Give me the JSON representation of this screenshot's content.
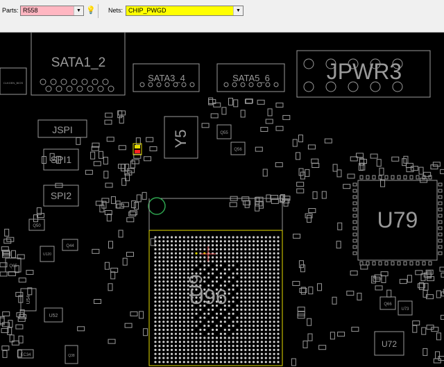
{
  "toolbar": {
    "parts_label": "Parts:",
    "parts_value": "R558",
    "nets_label": "Nets:",
    "nets_value": "CHIP_PWGD",
    "parts_bg": "#ffb6c1",
    "nets_bg": "#ffff00"
  },
  "board": {
    "components": {
      "sata1": "SATA1_2",
      "sata3": "SATA3_4",
      "sata5": "SATA5_6",
      "jpwr3": "JPWR3",
      "jspi": "JSPI",
      "spi1": "SPI1",
      "spi2": "SPI2",
      "y5": "Y5",
      "u79": "U79",
      "u96": "U96",
      "u96b": "U9",
      "q55": "Q55",
      "q56": "Q56",
      "q50": "Q50",
      "q44": "Q44",
      "q65": "Q65",
      "q66": "Q66",
      "u54": "U54",
      "u52": "U52",
      "u72": "U72",
      "u73": "U73",
      "u120": "U120",
      "ec34": "EC34",
      "q38": "Q38",
      "small_left": "CLKGEN_BIOS"
    },
    "trace_color": "#9a9a9a",
    "highlight_color": "#e6dc00",
    "selected_color": "#ff2020"
  }
}
